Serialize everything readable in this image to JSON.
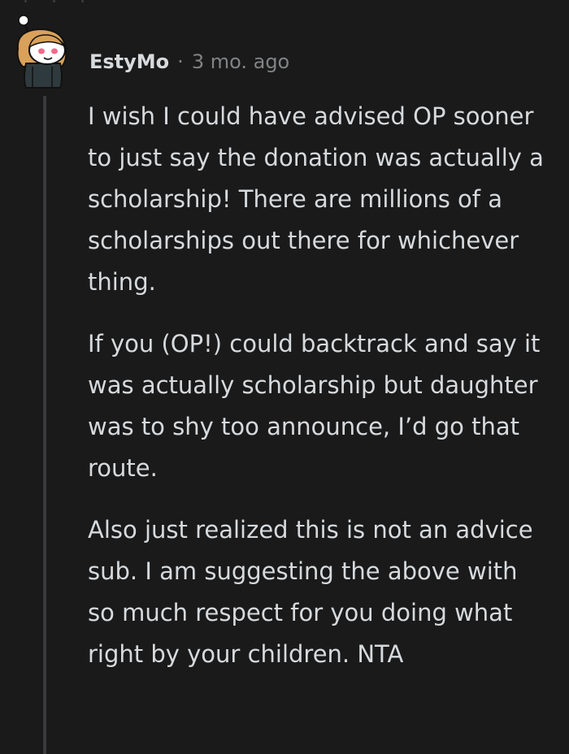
{
  "comment": {
    "username": "EstyMo",
    "separator": "·",
    "timestamp": "3 mo. ago",
    "avatar_icon": "snoo-avatar-icon",
    "paragraphs": [
      "I wish I could have advised OP sooner to just say the donation was actually a scholarship! There are millions of a scholarships out there for whichever thing.",
      "If you (OP!) could backtrack and say it was actually scholarship but daughter was to shy too announce, I’d go that route.",
      "Also just realized this is not an advice sub. I am suggesting the above with so much respect for you doing what right by your children. NTA"
    ]
  },
  "colors": {
    "background": "#1a1a1b",
    "text": "#d7dadc",
    "meta": "#818384",
    "thread_line": "#3a3a3c"
  }
}
